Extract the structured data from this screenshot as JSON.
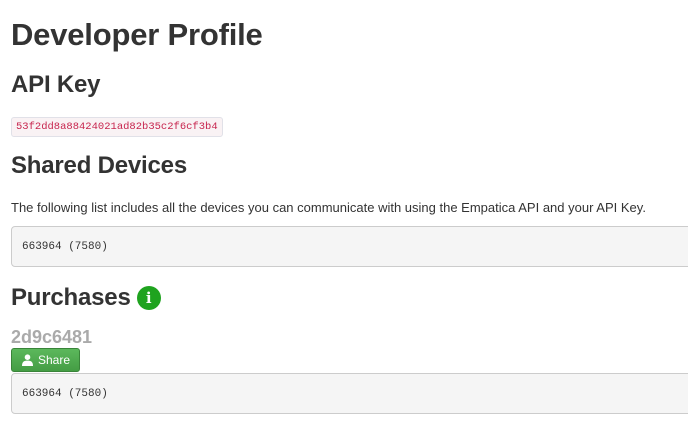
{
  "page": {
    "title": "Developer Profile"
  },
  "api_key": {
    "heading": "API Key",
    "value": "53f2dd8a88424021ad82b35c2f6cf3b4"
  },
  "shared_devices": {
    "heading": "Shared Devices",
    "description": "The following list includes all the devices you can communicate with using the Empatica API and your API Key.",
    "devices": [
      "663964 (7580)"
    ]
  },
  "purchases": {
    "heading": "Purchases",
    "info_icon": "info-icon",
    "items": [
      {
        "id": "2d9c6481",
        "share_label": "Share",
        "share_icon": "user-icon",
        "devices": [
          "663964 (7580)"
        ]
      }
    ]
  },
  "colors": {
    "text": "#333333",
    "api_key_text": "#c7254e",
    "info_icon": "#1fa31f",
    "share_button": "#5cb85c",
    "purchase_id": "#aaaaaa",
    "device_box_bg": "#f5f5f5"
  }
}
